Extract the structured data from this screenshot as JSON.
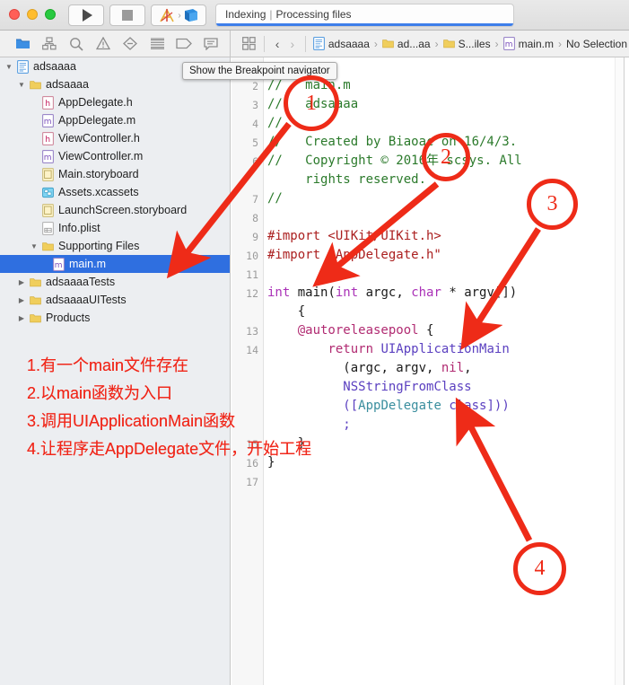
{
  "window": {
    "traffic_lights": [
      "close",
      "minimize",
      "maximize"
    ],
    "run_button": "run-button",
    "stop_button": "stop-button",
    "scheme_label": "Xcode scheme"
  },
  "status": {
    "primary": "Indexing",
    "separator": "|",
    "secondary": "Processing files"
  },
  "navigator_toolbar": {
    "icons": [
      {
        "name": "project-navigator-icon",
        "active": true
      },
      {
        "name": "source-control-navigator-icon",
        "active": false
      },
      {
        "name": "search-navigator-icon",
        "active": false
      },
      {
        "name": "issue-navigator-icon",
        "active": false
      },
      {
        "name": "test-navigator-icon",
        "active": false
      },
      {
        "name": "debug-navigator-icon",
        "active": false
      },
      {
        "name": "breakpoint-navigator-icon",
        "active": false
      },
      {
        "name": "report-navigator-icon",
        "active": false
      }
    ]
  },
  "breadcrumb": {
    "back_arrow": "‹",
    "forward_arrow": "›",
    "items": [
      {
        "label": "adsaaaa",
        "icon": "project-icon"
      },
      {
        "label": "ad...aa",
        "icon": "folder-icon"
      },
      {
        "label": "S...iles",
        "icon": "folder-icon"
      },
      {
        "label": "main.m",
        "icon": "m-file-icon"
      },
      {
        "label": "No Selection",
        "icon": "none"
      }
    ],
    "separator": "›"
  },
  "tooltip": {
    "text": "Show the Breakpoint navigator"
  },
  "sidebar": {
    "items": [
      {
        "label": "adsaaaa",
        "indent": 0,
        "twisty": "open",
        "icon": "project-icon",
        "selected": false
      },
      {
        "label": "adsaaaa",
        "indent": 1,
        "twisty": "open",
        "icon": "folder-icon",
        "selected": false
      },
      {
        "label": "AppDelegate.h",
        "indent": 2,
        "twisty": "none",
        "icon": "h-file-icon",
        "selected": false
      },
      {
        "label": "AppDelegate.m",
        "indent": 2,
        "twisty": "none",
        "icon": "m-file-icon",
        "selected": false
      },
      {
        "label": "ViewController.h",
        "indent": 2,
        "twisty": "none",
        "icon": "h-file-icon",
        "selected": false
      },
      {
        "label": "ViewController.m",
        "indent": 2,
        "twisty": "none",
        "icon": "m-file-icon",
        "selected": false
      },
      {
        "label": "Main.storyboard",
        "indent": 2,
        "twisty": "none",
        "icon": "storyboard-icon",
        "selected": false
      },
      {
        "label": "Assets.xcassets",
        "indent": 2,
        "twisty": "none",
        "icon": "assets-icon",
        "selected": false
      },
      {
        "label": "LaunchScreen.storyboard",
        "indent": 2,
        "twisty": "none",
        "icon": "storyboard-icon",
        "selected": false
      },
      {
        "label": "Info.plist",
        "indent": 2,
        "twisty": "none",
        "icon": "plist-icon",
        "selected": false
      },
      {
        "label": "Supporting Files",
        "indent": 2,
        "twisty": "open",
        "icon": "folder-icon",
        "selected": false
      },
      {
        "label": "main.m",
        "indent": 3,
        "twisty": "none",
        "icon": "m-file-icon",
        "selected": true
      },
      {
        "label": "adsaaaaTests",
        "indent": 1,
        "twisty": "closed",
        "icon": "folder-icon",
        "selected": false
      },
      {
        "label": "adsaaaaUITests",
        "indent": 1,
        "twisty": "closed",
        "icon": "folder-icon",
        "selected": false
      },
      {
        "label": "Products",
        "indent": 1,
        "twisty": "closed",
        "icon": "folder-icon",
        "selected": false
      }
    ]
  },
  "editor": {
    "line_numbers": [
      "2",
      "3",
      "4",
      "5",
      "6",
      "7",
      "8",
      "9",
      "10",
      "11",
      "12",
      "13",
      "14",
      "15",
      "16",
      "17"
    ],
    "lines": [
      {
        "num": "2",
        "text": "//   main.m"
      },
      {
        "num": "3",
        "text": "//   adsaaaa"
      },
      {
        "num": "4",
        "text": "//"
      },
      {
        "num": "5",
        "text": "//   Created by Biaoac on 16/4/3."
      },
      {
        "num": "6",
        "text": "//   Copyright © 2016年 scsys. All"
      },
      {
        "num": "",
        "text": "     rights reserved."
      },
      {
        "num": "7",
        "text": "//"
      },
      {
        "num": "8",
        "text": ""
      },
      {
        "num": "9",
        "text": "#import <UIKit/UIKit.h>"
      },
      {
        "num": "10",
        "text": "#import \"AppDelegate.h\""
      },
      {
        "num": "11",
        "text": ""
      },
      {
        "num": "12",
        "text": "int main(int argc, char * argv[])"
      },
      {
        "num": "",
        "text": "    {"
      },
      {
        "num": "13",
        "text": "    @autoreleasepool {"
      },
      {
        "num": "14",
        "text": "        return UIApplicationMain"
      },
      {
        "num": "",
        "text": "          (argc, argv, nil,"
      },
      {
        "num": "",
        "text": "          NSStringFromClass"
      },
      {
        "num": "",
        "text": "          ([AppDelegate class]))"
      },
      {
        "num": "",
        "text": "          ;"
      },
      {
        "num": "15",
        "text": "    }"
      },
      {
        "num": "16",
        "text": "}"
      },
      {
        "num": "17",
        "text": ""
      }
    ]
  },
  "annotations": {
    "circles": [
      {
        "label": "1"
      },
      {
        "label": "2"
      },
      {
        "label": "3"
      },
      {
        "label": "4"
      }
    ],
    "notes": [
      "1.有一个main文件存在",
      "2.以main函数为入口",
      "3.调用UIApplicationMain函数",
      "4.让程序走AppDelegate文件，开始工程"
    ],
    "color": "#f0281b"
  }
}
